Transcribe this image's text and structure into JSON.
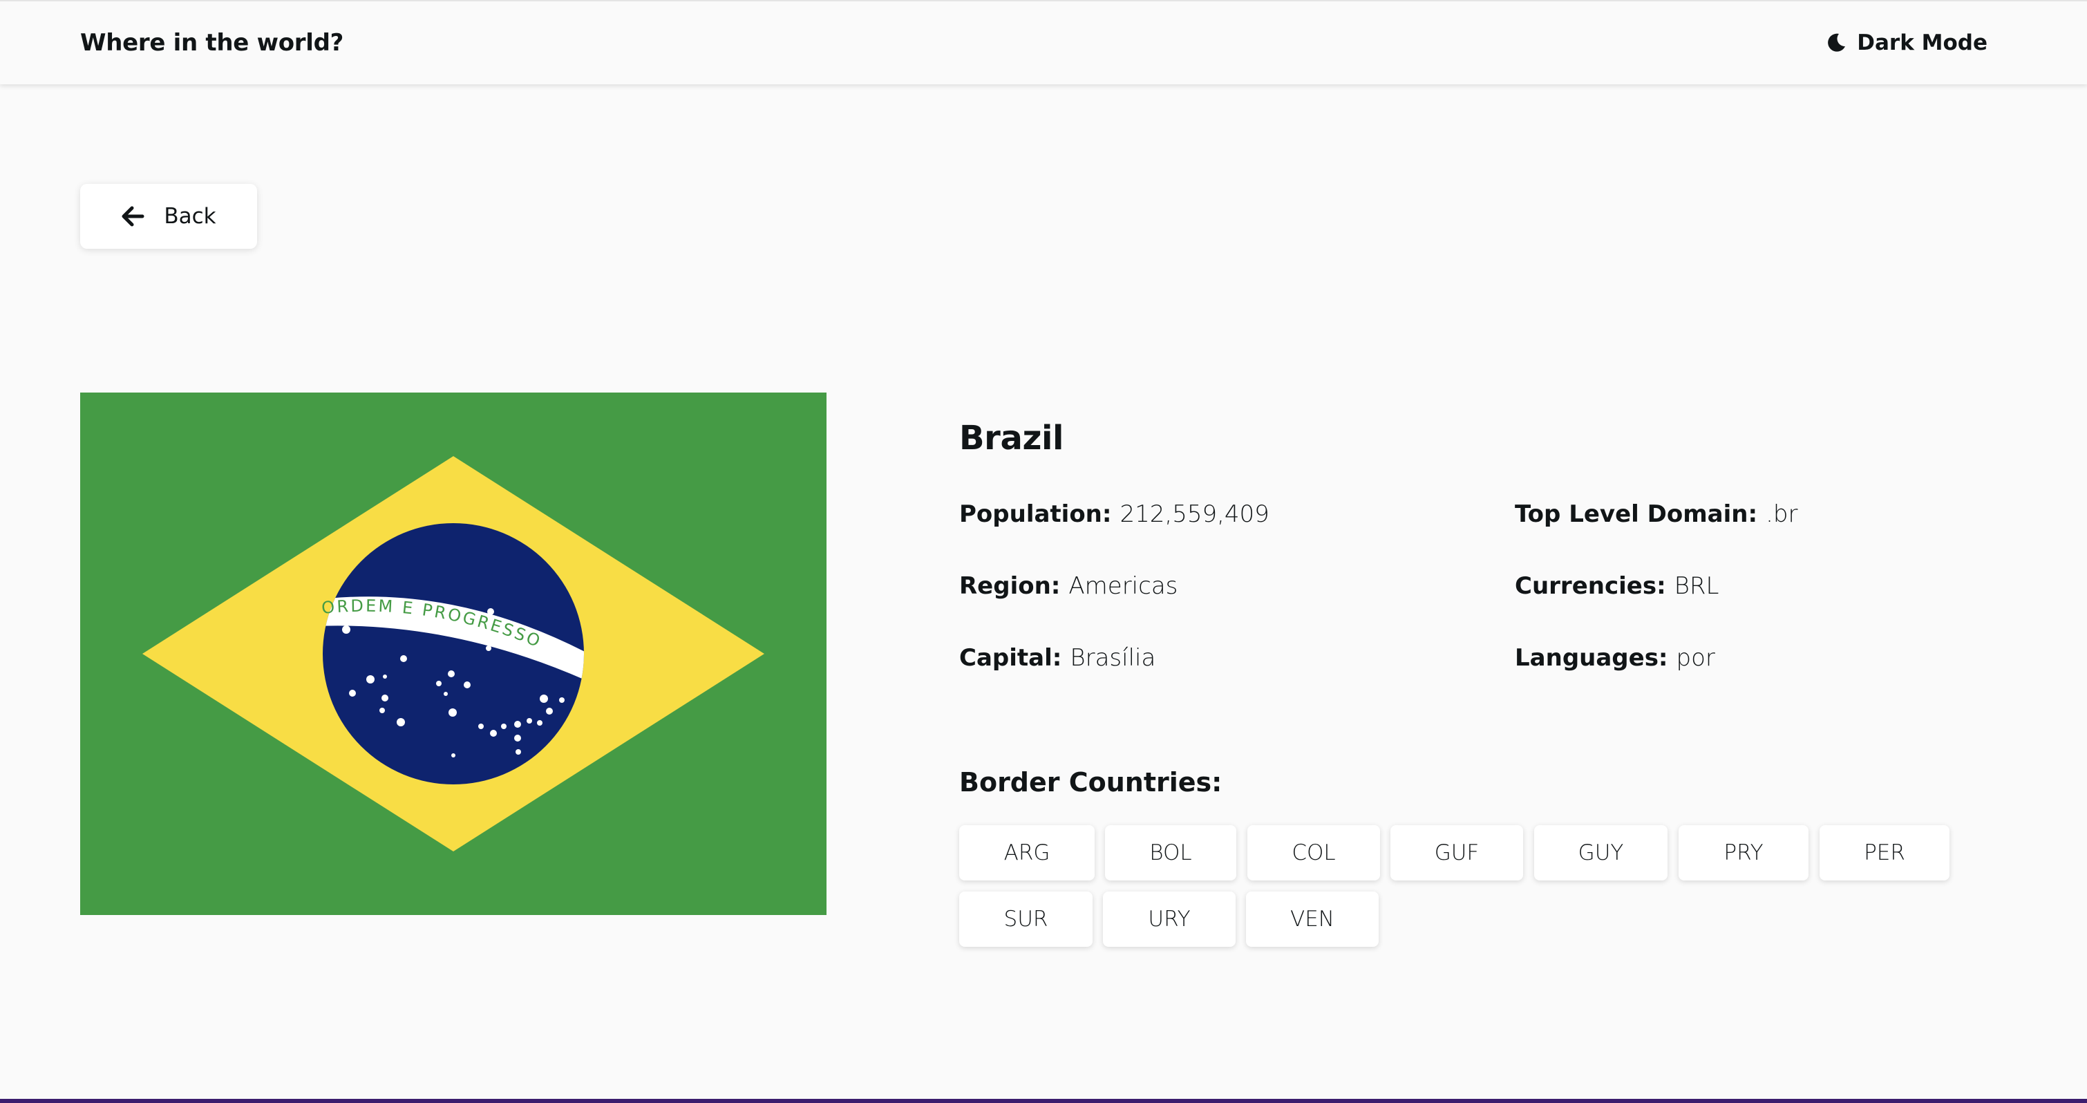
{
  "header": {
    "title": "Where in the world?",
    "theme_toggle": {
      "label": "Dark Mode",
      "icon": "moon-icon"
    }
  },
  "back_button": {
    "label": "Back",
    "icon": "arrow-left-icon"
  },
  "country": {
    "name": "Brazil",
    "flag": {
      "motto": "ORDEM E PROGRESSO",
      "colors": {
        "green": "#459B45",
        "yellow": "#F8DD45",
        "blue": "#0E236E",
        "white": "#FFFFFF"
      }
    },
    "info_left": [
      {
        "label": "Population:",
        "value": "212,559,409"
      },
      {
        "label": "Region:",
        "value": "Americas"
      },
      {
        "label": "Capital:",
        "value": "Brasília"
      }
    ],
    "info_right": [
      {
        "label": "Top Level Domain:",
        "value": ".br"
      },
      {
        "label": "Currencies:",
        "value": "BRL"
      },
      {
        "label": "Languages:",
        "value": "por"
      }
    ],
    "border_title": "Border Countries:",
    "borders": [
      "ARG",
      "BOL",
      "COL",
      "GUF",
      "GUY",
      "PRY",
      "PER",
      "SUR",
      "URY",
      "VEN"
    ]
  },
  "theme": {
    "background": "#fafafa",
    "surface": "#ffffff",
    "text": "#111517"
  }
}
